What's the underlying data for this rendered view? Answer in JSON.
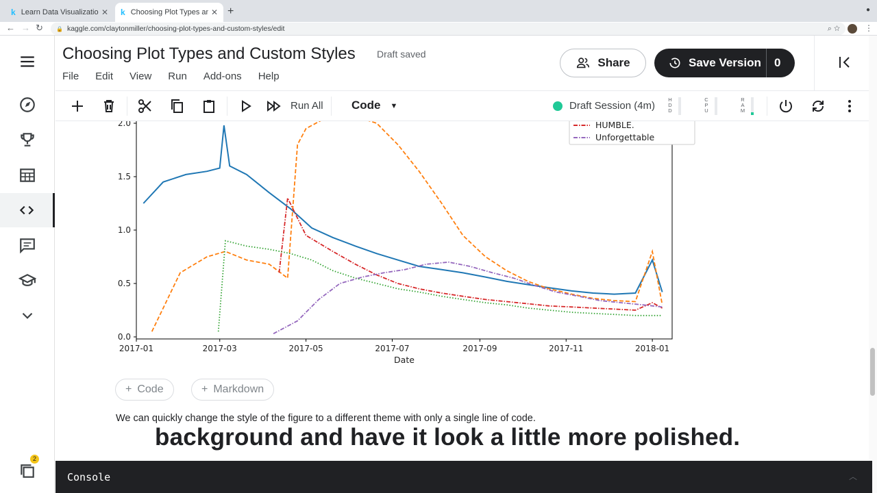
{
  "browser": {
    "tabs": [
      {
        "label": "Learn Data Visualization Tutorials",
        "favicon": "k",
        "active": false
      },
      {
        "label": "Choosing Plot Types and Custom Styles",
        "favicon": "k",
        "active": true
      }
    ],
    "url": "kaggle.com/claytonmiller/choosing-plot-types-and-custom-styles/edit"
  },
  "sidebar": {
    "items": [
      {
        "icon": "menu-icon"
      },
      {
        "icon": "compass-icon"
      },
      {
        "icon": "trophy-icon"
      },
      {
        "icon": "table-icon"
      },
      {
        "icon": "code-icon",
        "active": true
      },
      {
        "icon": "comment-icon"
      },
      {
        "icon": "school-icon"
      },
      {
        "icon": "chevron-down-icon"
      }
    ],
    "notifications_count": "2"
  },
  "header": {
    "title": "Choosing Plot Types and Custom Styles",
    "status": "Draft saved",
    "menu": [
      "File",
      "Edit",
      "View",
      "Run",
      "Add-ons",
      "Help"
    ],
    "share_label": "Share",
    "save_label": "Save Version",
    "save_count": "0"
  },
  "toolbar": {
    "run_all_label": "Run All",
    "cell_type": "Code",
    "session_label": "Draft Session (4m)",
    "session_color": "#20c997",
    "meters": [
      {
        "label": "HDD",
        "level": 0
      },
      {
        "label": "CPU",
        "level": 0
      },
      {
        "label": "RAM",
        "level": 0.15
      }
    ]
  },
  "notebook": {
    "add_code_label": "Code",
    "add_markdown_label": "Markdown",
    "paragraph": "We can quickly change the style of the figure to a different theme with only a single line of code.",
    "caption": "background and have it look a little more polished."
  },
  "console_label": "Console",
  "chart_data": {
    "type": "line",
    "xlabel": "Date",
    "ylabel": "",
    "x_ticks": [
      "2017-01",
      "2017-03",
      "2017-05",
      "2017-07",
      "2017-09",
      "2017-11",
      "2018-01"
    ],
    "y_ticks": [
      "0.0",
      "0.5",
      "1.0",
      "1.5",
      "2.0"
    ],
    "ylim": [
      0,
      2.05
    ],
    "legend": {
      "position": "top-right",
      "visible_entries": [
        "HUMBLE.",
        "Unforgettable"
      ]
    },
    "series": [
      {
        "color": "#1f77b4",
        "dash": "solid",
        "x": [
          "2017-01-06",
          "2017-01-20",
          "2017-02-05",
          "2017-02-20",
          "2017-03-01",
          "2017-03-04",
          "2017-03-08",
          "2017-03-20",
          "2017-04-05",
          "2017-04-20",
          "2017-05-05",
          "2017-05-20",
          "2017-06-05",
          "2017-06-20",
          "2017-07-05",
          "2017-07-20",
          "2017-08-05",
          "2017-08-20",
          "2017-09-05",
          "2017-09-20",
          "2017-10-05",
          "2017-10-20",
          "2017-11-05",
          "2017-11-20",
          "2017-12-05",
          "2017-12-20",
          "2018-01-01",
          "2018-01-08"
        ],
        "y": [
          1.25,
          1.45,
          1.52,
          1.55,
          1.58,
          1.98,
          1.6,
          1.52,
          1.35,
          1.2,
          1.02,
          0.93,
          0.85,
          0.78,
          0.72,
          0.66,
          0.63,
          0.6,
          0.56,
          0.52,
          0.49,
          0.46,
          0.43,
          0.41,
          0.4,
          0.41,
          0.72,
          0.42
        ]
      },
      {
        "color": "#ff7f0e",
        "dash": "dashed",
        "x": [
          "2017-01-12",
          "2017-02-01",
          "2017-02-20",
          "2017-03-05",
          "2017-03-20",
          "2017-04-05",
          "2017-04-18",
          "2017-04-25",
          "2017-05-01",
          "2017-05-15",
          "2017-06-01",
          "2017-06-20",
          "2017-07-05",
          "2017-07-20",
          "2017-08-05",
          "2017-08-20",
          "2017-09-05",
          "2017-09-20",
          "2017-10-05",
          "2017-10-20",
          "2017-11-05",
          "2017-11-20",
          "2017-12-05",
          "2017-12-20",
          "2018-01-01",
          "2018-01-08"
        ],
        "y": [
          0.05,
          0.6,
          0.75,
          0.8,
          0.72,
          0.68,
          0.55,
          1.8,
          1.95,
          2.05,
          2.08,
          2.0,
          1.8,
          1.55,
          1.25,
          0.95,
          0.75,
          0.62,
          0.52,
          0.45,
          0.4,
          0.36,
          0.34,
          0.33,
          0.8,
          0.3
        ]
      },
      {
        "color": "#d62728",
        "dash": "dashdot",
        "name": "HUMBLE.",
        "x": [
          "2017-04-12",
          "2017-04-18",
          "2017-05-01",
          "2017-05-20",
          "2017-06-05",
          "2017-06-20",
          "2017-07-05",
          "2017-07-20",
          "2017-08-05",
          "2017-08-20",
          "2017-09-05",
          "2017-09-20",
          "2017-10-05",
          "2017-10-20",
          "2017-11-05",
          "2017-11-20",
          "2017-12-05",
          "2017-12-20",
          "2018-01-01",
          "2018-01-08"
        ],
        "y": [
          0.6,
          1.3,
          0.95,
          0.8,
          0.68,
          0.58,
          0.5,
          0.45,
          0.41,
          0.38,
          0.35,
          0.33,
          0.31,
          0.29,
          0.28,
          0.27,
          0.26,
          0.25,
          0.32,
          0.27
        ]
      },
      {
        "color": "#2ca02c",
        "dash": "dotted",
        "x": [
          "2017-02-28",
          "2017-03-05",
          "2017-03-20",
          "2017-04-05",
          "2017-04-20",
          "2017-05-05",
          "2017-05-20",
          "2017-06-05",
          "2017-06-20",
          "2017-07-05",
          "2017-07-20",
          "2017-08-05",
          "2017-08-20",
          "2017-09-05",
          "2017-09-20",
          "2017-10-05",
          "2017-10-20",
          "2017-11-05",
          "2017-11-20",
          "2017-12-05",
          "2017-12-20",
          "2018-01-01",
          "2018-01-08"
        ],
        "y": [
          0.05,
          0.9,
          0.85,
          0.82,
          0.78,
          0.72,
          0.62,
          0.55,
          0.5,
          0.45,
          0.42,
          0.38,
          0.35,
          0.32,
          0.3,
          0.27,
          0.25,
          0.23,
          0.22,
          0.21,
          0.2,
          0.2,
          0.2
        ]
      },
      {
        "color": "#9467bd",
        "dash": "dashdot",
        "name": "Unforgettable",
        "x": [
          "2017-04-08",
          "2017-04-25",
          "2017-05-10",
          "2017-05-25",
          "2017-06-10",
          "2017-06-25",
          "2017-07-10",
          "2017-07-25",
          "2017-08-10",
          "2017-08-25",
          "2017-09-10",
          "2017-09-25",
          "2017-10-10",
          "2017-10-25",
          "2017-11-10",
          "2017-11-25",
          "2017-12-10",
          "2017-12-25",
          "2018-01-08"
        ],
        "y": [
          0.03,
          0.15,
          0.35,
          0.5,
          0.56,
          0.6,
          0.63,
          0.68,
          0.7,
          0.66,
          0.6,
          0.55,
          0.48,
          0.42,
          0.38,
          0.34,
          0.32,
          0.3,
          0.28
        ]
      }
    ]
  }
}
